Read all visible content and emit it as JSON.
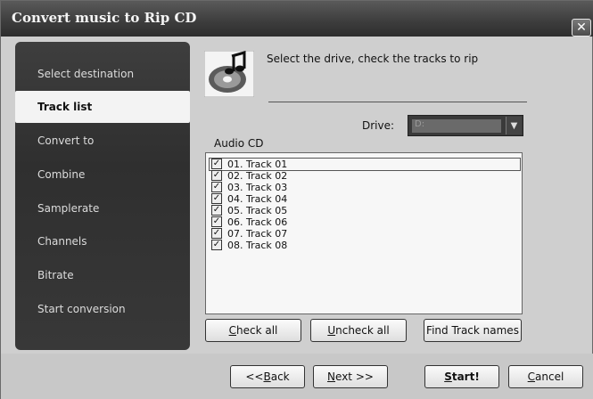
{
  "window": {
    "title": "Convert music to Rip CD",
    "close_glyph": "✕"
  },
  "sidebar": {
    "items": [
      {
        "label": "Select destination",
        "active": false
      },
      {
        "label": "Track list",
        "active": true
      },
      {
        "label": "Convert to",
        "active": false
      },
      {
        "label": "Combine",
        "active": false
      },
      {
        "label": "Samplerate",
        "active": false
      },
      {
        "label": "Channels",
        "active": false
      },
      {
        "label": "Bitrate",
        "active": false
      },
      {
        "label": "Start conversion",
        "active": false
      }
    ]
  },
  "header": {
    "icon": "music-cd-icon",
    "instruction": "Select the drive, check the tracks to rip"
  },
  "drive": {
    "label": "Drive:",
    "selected": "D:"
  },
  "audio_cd": {
    "label": "Audio CD",
    "tracks": [
      {
        "label": "01. Track 01",
        "checked": true
      },
      {
        "label": "02. Track 02",
        "checked": true
      },
      {
        "label": "03. Track 03",
        "checked": true
      },
      {
        "label": "04. Track 04",
        "checked": true
      },
      {
        "label": "05. Track 05",
        "checked": true
      },
      {
        "label": "06. Track 06",
        "checked": true
      },
      {
        "label": "07. Track 07",
        "checked": true
      },
      {
        "label": "08. Track 08",
        "checked": true
      }
    ],
    "check_mark": "✓"
  },
  "actions": {
    "check_all_mn": "C",
    "check_all_rest": "heck all",
    "uncheck_all_mn": "U",
    "uncheck_all_rest": "ncheck all",
    "find_track_names": "Find Track names"
  },
  "footer": {
    "back_pre": "<< ",
    "back_mn": "B",
    "back_rest": "ack",
    "next_mn": "N",
    "next_rest": "ext >>",
    "start_mn": "S",
    "start_rest": "tart!",
    "cancel_mn": "C",
    "cancel_rest": "ancel"
  }
}
